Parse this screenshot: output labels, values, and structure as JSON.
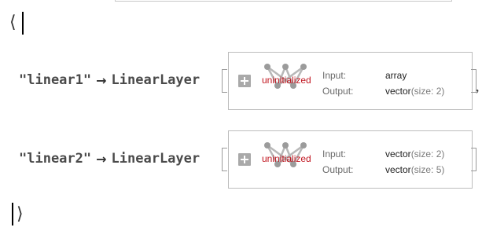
{
  "association": {
    "open_bracket": "⟨",
    "close_bracket": "⟩",
    "separator": ","
  },
  "layers": [
    {
      "key": "\"linear1\"",
      "arrow": "→",
      "head": "LinearLayer",
      "status": "uninitialized",
      "input_label": "Input:",
      "input_value": "array",
      "input_size": "",
      "output_label": "Output:",
      "output_value": "vector",
      "output_size": "(size: 2)"
    },
    {
      "key": "\"linear2\"",
      "arrow": "→",
      "head": "LinearLayer",
      "status": "uninitialized",
      "input_label": "Input:",
      "input_value": "vector",
      "input_size": "(size: 2)",
      "output_label": "Output:",
      "output_value": "vector",
      "output_size": "(size: 5)"
    }
  ],
  "icons": [
    "expand-plus-icon",
    "network-graph-icon"
  ],
  "colors": {
    "status": "#c0141e",
    "text": "#333333",
    "panel_border": "#bdbdbd"
  }
}
